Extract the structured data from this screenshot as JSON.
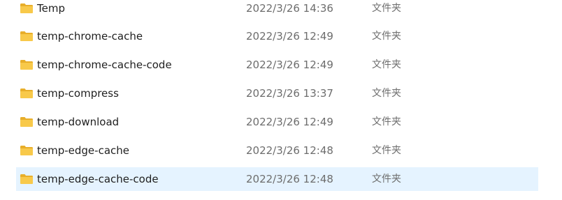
{
  "files": [
    {
      "name": "Temp",
      "date": "2022/3/26 14:36",
      "type": "文件夹",
      "icon": "folder-icon",
      "selected": false
    },
    {
      "name": "temp-chrome-cache",
      "date": "2022/3/26 12:49",
      "type": "文件夹",
      "icon": "folder-icon",
      "selected": false
    },
    {
      "name": "temp-chrome-cache-code",
      "date": "2022/3/26 12:49",
      "type": "文件夹",
      "icon": "folder-icon",
      "selected": false
    },
    {
      "name": "temp-compress",
      "date": "2022/3/26 13:37",
      "type": "文件夹",
      "icon": "folder-icon",
      "selected": false
    },
    {
      "name": "temp-download",
      "date": "2022/3/26 12:49",
      "type": "文件夹",
      "icon": "folder-icon",
      "selected": false
    },
    {
      "name": "temp-edge-cache",
      "date": "2022/3/26 12:48",
      "type": "文件夹",
      "icon": "folder-icon",
      "selected": false
    },
    {
      "name": "temp-edge-cache-code",
      "date": "2022/3/26 12:48",
      "type": "文件夹",
      "icon": "folder-icon",
      "selected": true
    }
  ],
  "colors": {
    "folder": "#f8c94a",
    "folder_dark": "#e8ae2a",
    "selection": "#e5f3ff"
  }
}
